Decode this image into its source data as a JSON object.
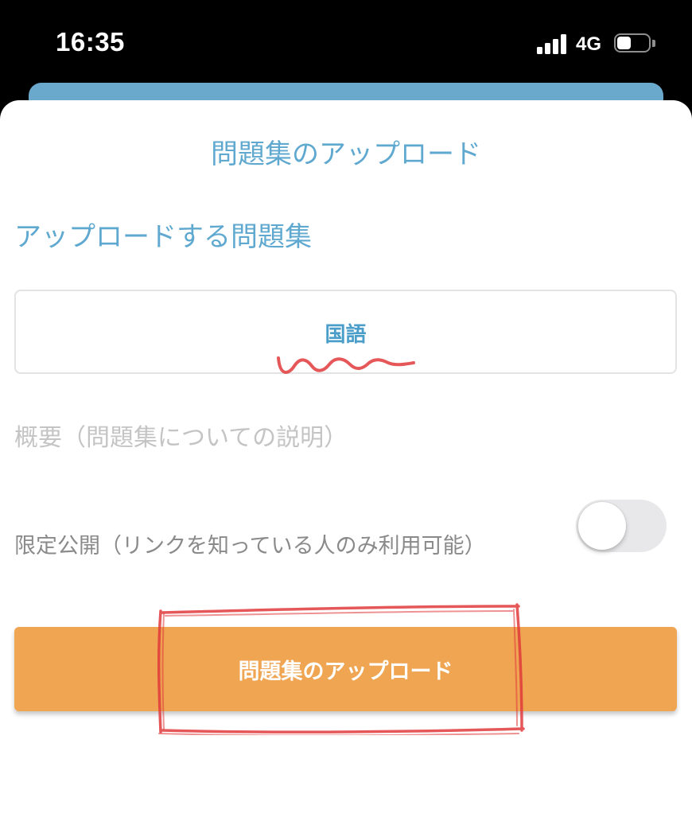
{
  "status_bar": {
    "time": "16:35",
    "network": "4G",
    "signal_bars": 4,
    "battery_level": 0.45
  },
  "sheet": {
    "title": "問題集のアップロード"
  },
  "form": {
    "section_label": "アップロードする問題集",
    "selected_workbook": "国語",
    "summary_placeholder": "概要（問題集についての説明）",
    "summary_value": "",
    "limited_public_label": "限定公開（リンクを知っている人のみ利用可能）",
    "limited_public_enabled": false,
    "upload_button_label": "問題集のアップロード"
  },
  "colors": {
    "accent_blue": "#5fa8cf",
    "button_orange": "#efa552",
    "annotation_red": "#e0393b"
  }
}
